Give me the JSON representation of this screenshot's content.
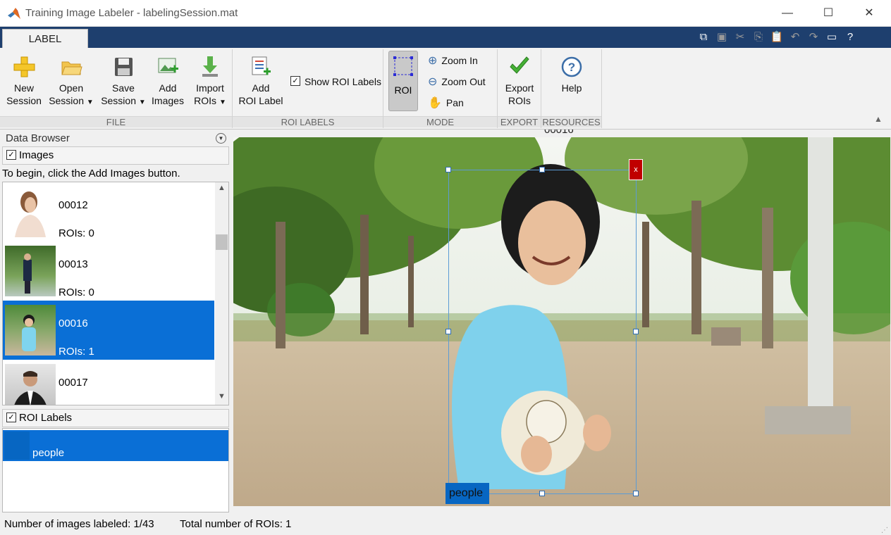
{
  "window": {
    "title": "Training Image Labeler - labelingSession.mat",
    "minimize": "—",
    "maximize": "☐",
    "close": "✕"
  },
  "tabs": [
    {
      "label": "LABEL"
    }
  ],
  "ribbon": {
    "file": {
      "caption": "FILE",
      "new_session": [
        "New",
        "Session"
      ],
      "open_session": [
        "Open",
        "Session"
      ],
      "save_session": [
        "Save",
        "Session"
      ],
      "add_images": [
        "Add",
        "Images"
      ],
      "import_rois": [
        "Import",
        "ROIs"
      ]
    },
    "roi_labels": {
      "caption": "ROI LABELS",
      "add_roi_label": [
        "Add",
        "ROI Label"
      ],
      "show_roi_labels": "Show ROI Labels",
      "show_roi_labels_checked": true
    },
    "mode": {
      "caption": "MODE",
      "roi": "ROI",
      "zoom_in": "Zoom In",
      "zoom_out": "Zoom Out",
      "pan": "Pan"
    },
    "export": {
      "caption": "EXPORT",
      "export_rois": [
        "Export",
        "ROIs"
      ]
    },
    "resources": {
      "caption": "RESOURCES",
      "help": "Help"
    }
  },
  "data_browser": {
    "title": "Data Browser",
    "images_header": "Images",
    "hint": "To begin, click the Add Images button.",
    "items": [
      {
        "name": "00012",
        "rois": "ROIs: 0",
        "selected": false
      },
      {
        "name": "00013",
        "rois": "ROIs: 0",
        "selected": false
      },
      {
        "name": "00016",
        "rois": "ROIs: 1",
        "selected": true
      },
      {
        "name": "00017",
        "rois": "",
        "selected": false
      }
    ],
    "roi_labels_header": "ROI Labels",
    "roi_labels": [
      {
        "label": "people",
        "color": "#0a6fd6"
      }
    ]
  },
  "canvas": {
    "image_name_partial": "00016",
    "roi_label": "people",
    "delete_glyph": "x"
  },
  "status": {
    "labeled": "Number of images labeled: 1/43",
    "total_rois": "Total number of ROIs: 1"
  },
  "colors": {
    "accent": "#0a6fd6",
    "tabstrip": "#1e3f6e",
    "roi_box": "#5b9bd5",
    "delete": "#c00000"
  }
}
